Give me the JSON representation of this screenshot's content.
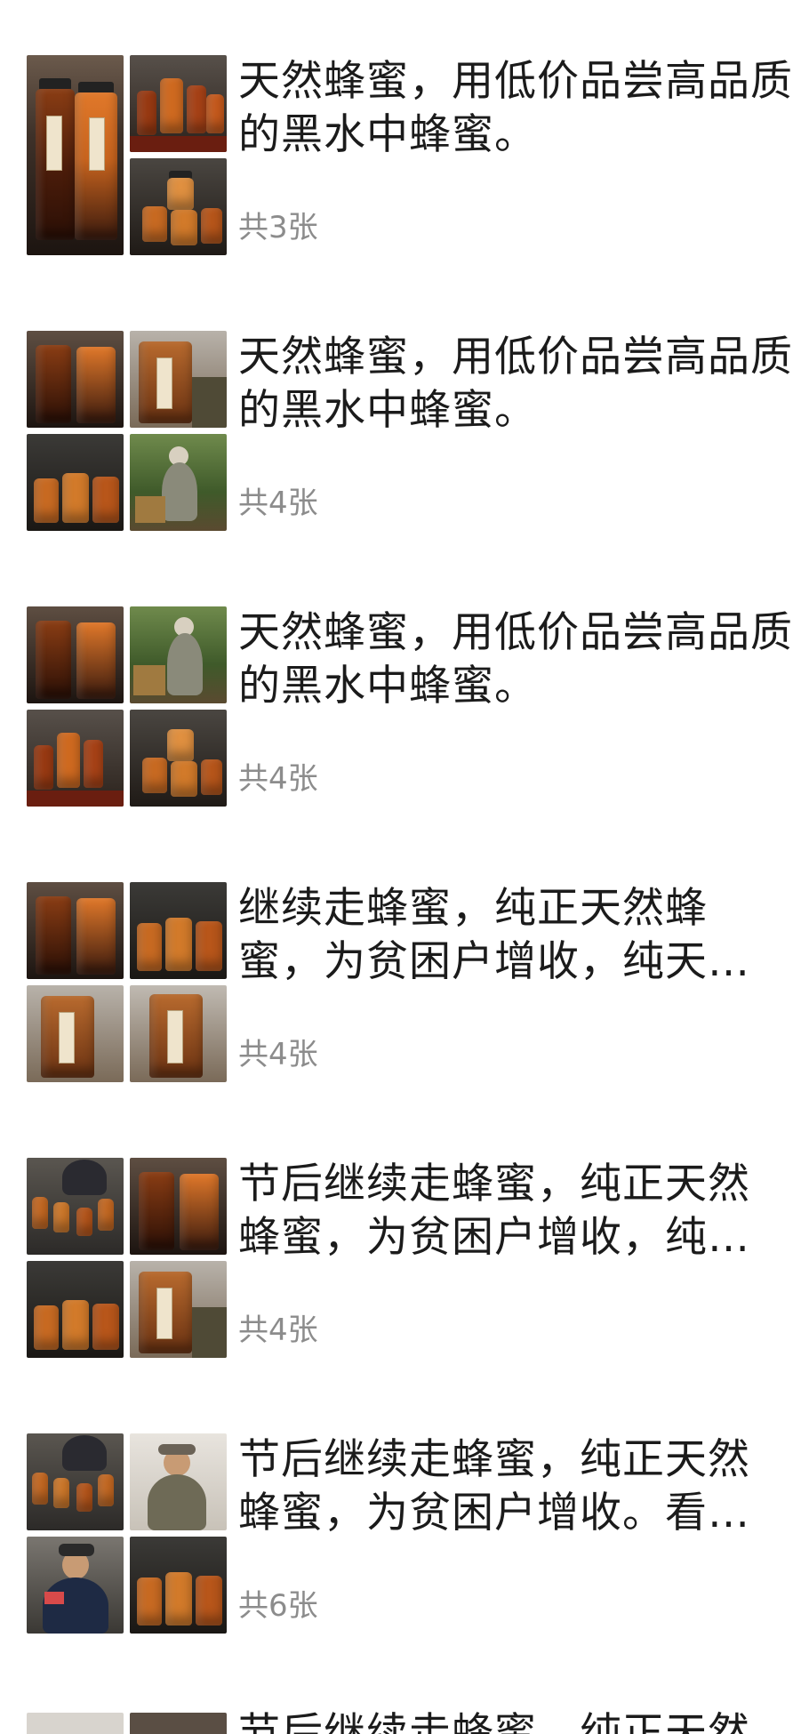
{
  "posts": [
    {
      "title": "天然蜂蜜，用低价品尝高品质的黑水中蜂蜜。",
      "count": "共3张"
    },
    {
      "title": "天然蜂蜜，用低价品尝高品质的黑水中蜂蜜。",
      "count": "共4张"
    },
    {
      "title": "天然蜂蜜，用低价品尝高品质的黑水中蜂蜜。",
      "count": "共4张"
    },
    {
      "title": "继续走蜂蜜，纯正天然蜂\n蜜，为贫困户增收，纯天…",
      "count": "共4张"
    },
    {
      "title": "节后继续走蜂蜜，纯正天然\n蜂蜜，为贫困户增收，纯…",
      "count": "共4张"
    },
    {
      "title": "节后继续走蜂蜜，纯正天然\n蜂蜜，为贫困户增收。看…",
      "count": "共6张"
    }
  ],
  "partial_post": {
    "title": "节后继续走蜂蜜，纯正天然"
  },
  "colors": {
    "background": "#ffffff",
    "text": "#1b1b1b",
    "count_text": "#8c8c8c",
    "honey_amber": "#c8641e",
    "honey_dark": "#3a1a0e"
  }
}
